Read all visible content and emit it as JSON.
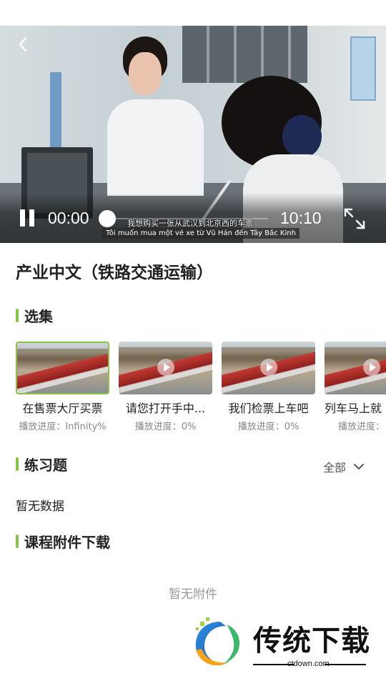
{
  "player": {
    "current_time": "00:00",
    "total_time": "10:10",
    "progress_fraction": 0.0,
    "subtitle_cn": "我想购买一张从武汉到北京西的车票",
    "subtitle_vn": "Tôi muốn mua một vé xe từ Vũ Hán đến Tây Bắc Kinh"
  },
  "course": {
    "title": "产业中文（铁路交通运输）"
  },
  "sections": {
    "episodes_label": "选集",
    "exercises_label": "练习题",
    "attachments_label": "课程附件下载"
  },
  "episodes": [
    {
      "title": "在售票大厅买票",
      "progress": "播放进度：Infinity%"
    },
    {
      "title": "请您打开手中...",
      "progress": "播放进度：0%"
    },
    {
      "title": "我们检票上车吧",
      "progress": "播放进度：0%"
    },
    {
      "title": "列车马上就",
      "progress": "播放进度："
    }
  ],
  "exercises": {
    "filter_label": "全部",
    "empty_text": "暂无数据"
  },
  "attachments": {
    "empty_text": "暂无附件"
  },
  "watermark": {
    "brand": "传统下载",
    "url": "ctdown.com"
  },
  "colors": {
    "accent": "#8bc34a",
    "muted": "#999999"
  }
}
